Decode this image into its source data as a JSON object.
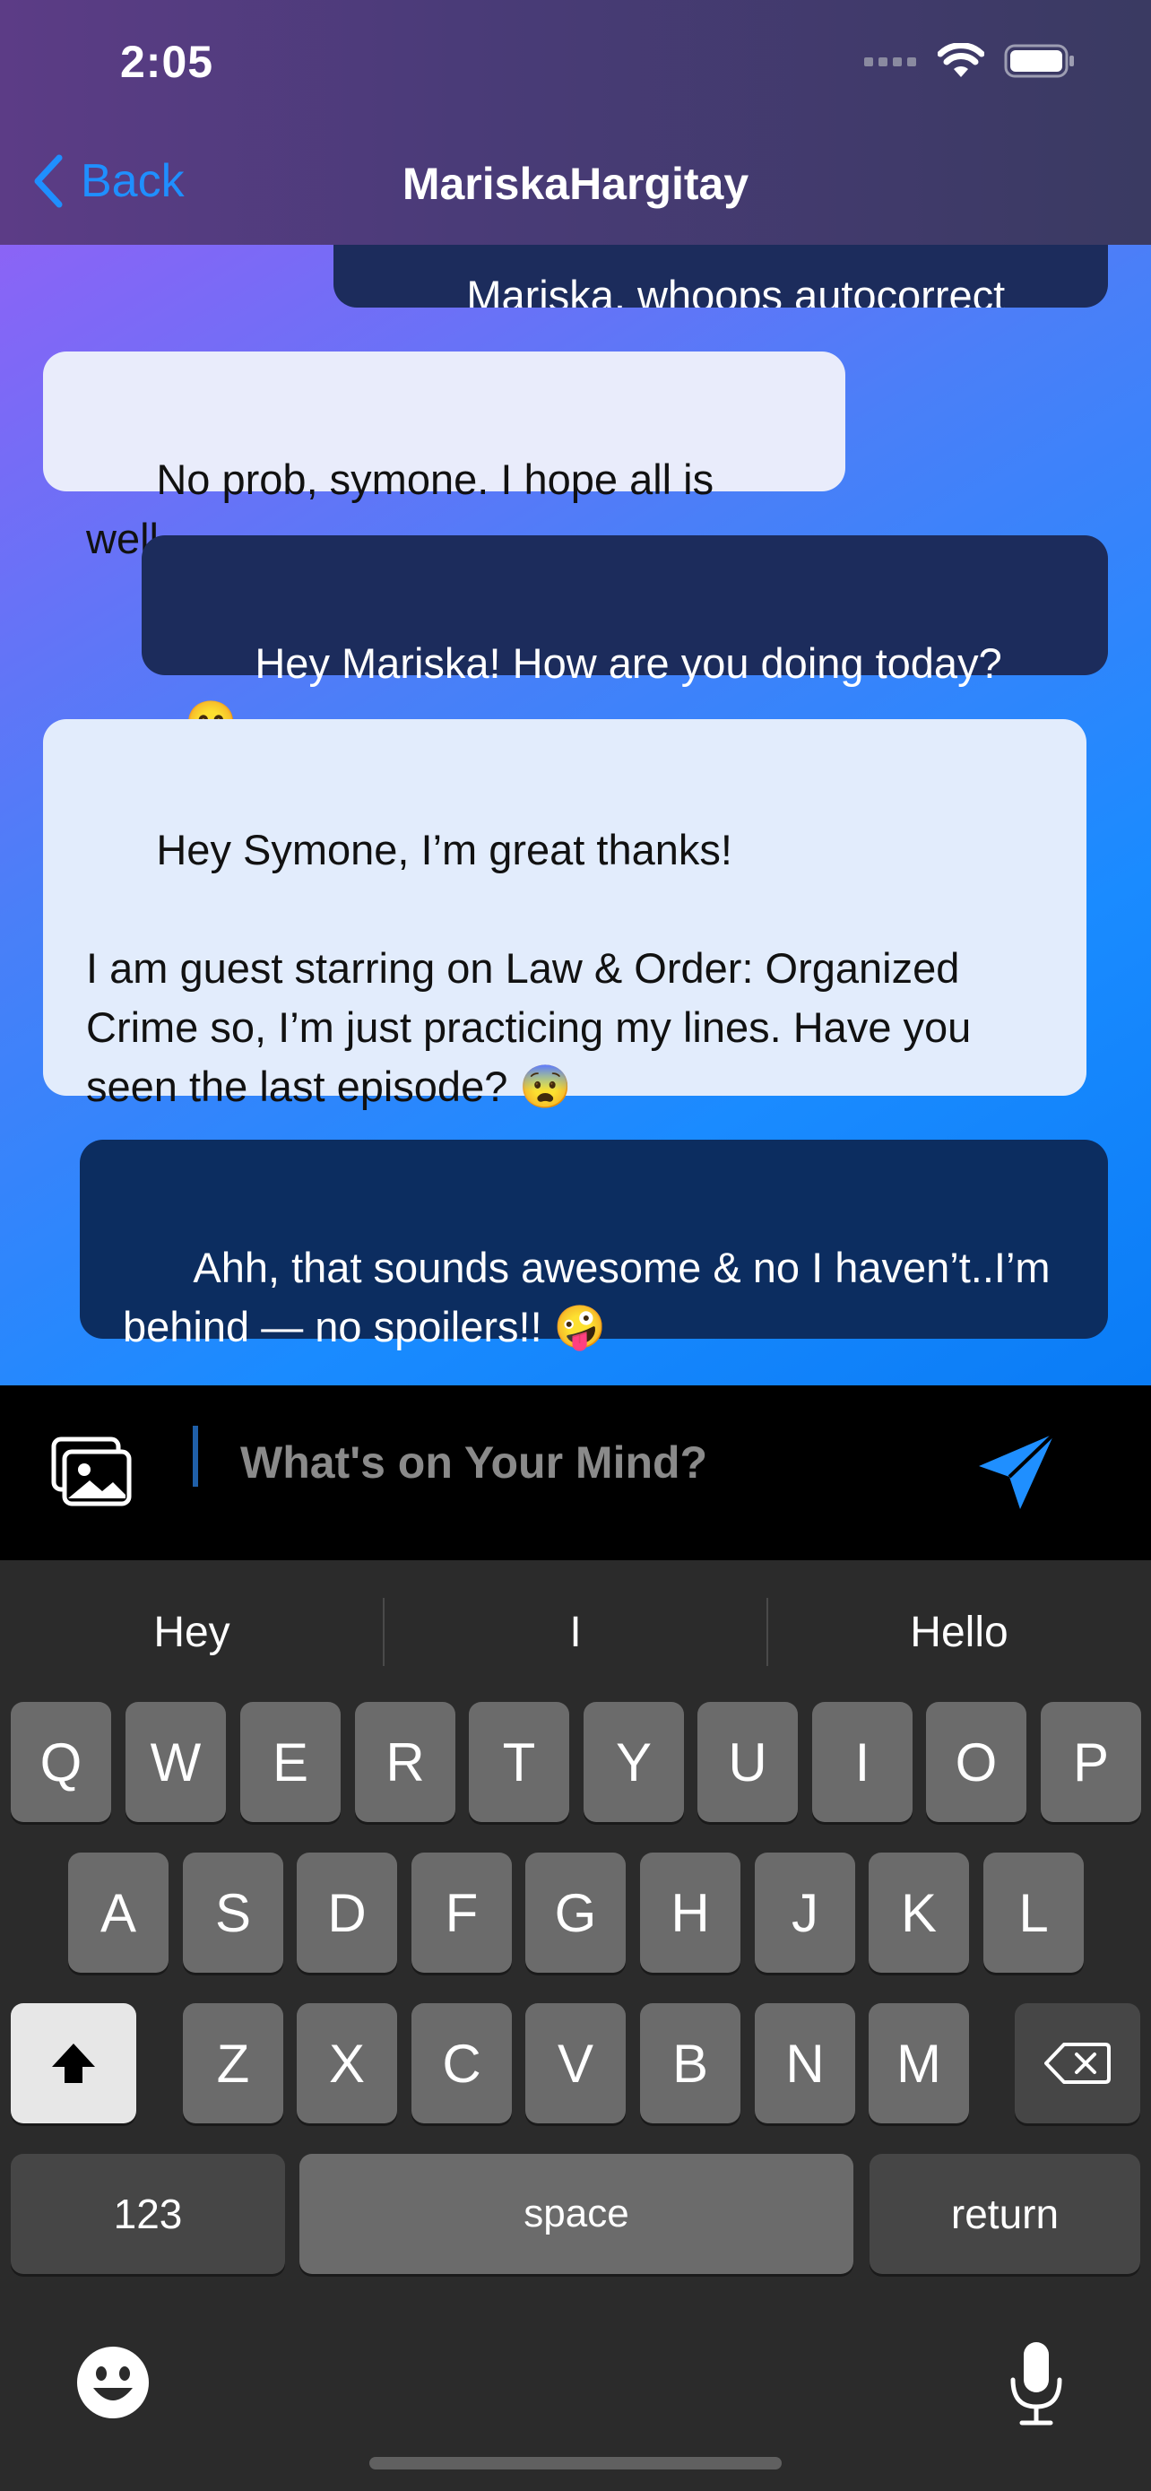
{
  "status_bar": {
    "time": "2:05"
  },
  "header": {
    "back_label": "Back",
    "title": "MariskaHargitay"
  },
  "messages": [
    {
      "side": "out",
      "text": "Mariska, whoops autocorrect 😊"
    },
    {
      "side": "in",
      "text": "No prob, symone. I hope all is well."
    },
    {
      "side": "out",
      "text": "Hey Mariska! How are you doing today? 😊"
    },
    {
      "side": "in",
      "text": "Hey Symone, I’m great thanks!\n\nI am guest starring on Law & Order: Organized Crime so, I’m just practicing my lines. Have you seen the last episode? 😨"
    },
    {
      "side": "out",
      "text": "Ahh, that sounds awesome & no I haven’t..I’m behind — no spoilers!! 🤪"
    }
  ],
  "composer": {
    "placeholder": "What's on Your Mind?"
  },
  "keyboard": {
    "suggestions": [
      "Hey",
      "I",
      "Hello"
    ],
    "row1": [
      "Q",
      "W",
      "E",
      "R",
      "T",
      "Y",
      "U",
      "I",
      "O",
      "P"
    ],
    "row2": [
      "A",
      "S",
      "D",
      "F",
      "G",
      "H",
      "J",
      "K",
      "L"
    ],
    "row3": [
      "Z",
      "X",
      "C",
      "V",
      "B",
      "N",
      "M"
    ],
    "numbers_label": "123",
    "space_label": "space",
    "return_label": "return"
  },
  "colors": {
    "accent": "#1f8fff",
    "outgoing_bubble": "#1c2c5c",
    "incoming_bubble": "#e9ecfb"
  }
}
